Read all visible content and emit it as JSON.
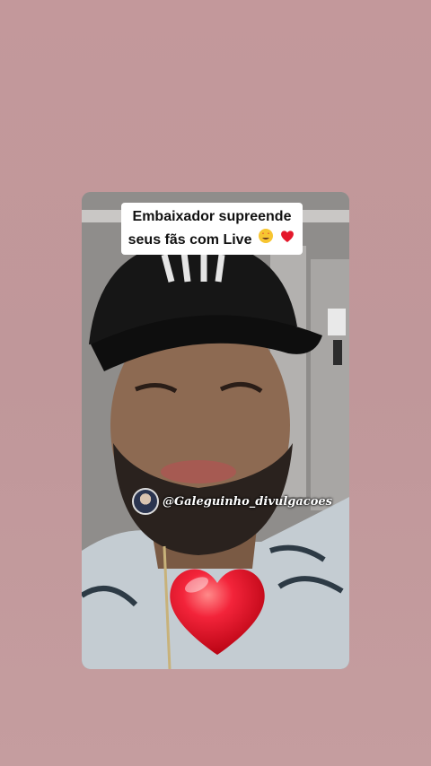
{
  "story": {
    "caption_line1": "Embaixador supreende",
    "caption_line2": "seus fãs com Live",
    "caption_emojis": [
      "star-struck-emoji",
      "red-heart-emoji"
    ],
    "watermark_handle": "@Galeguinho_divulgacoes",
    "background_color": "#c3989b",
    "heart_color": "#e8192c"
  }
}
